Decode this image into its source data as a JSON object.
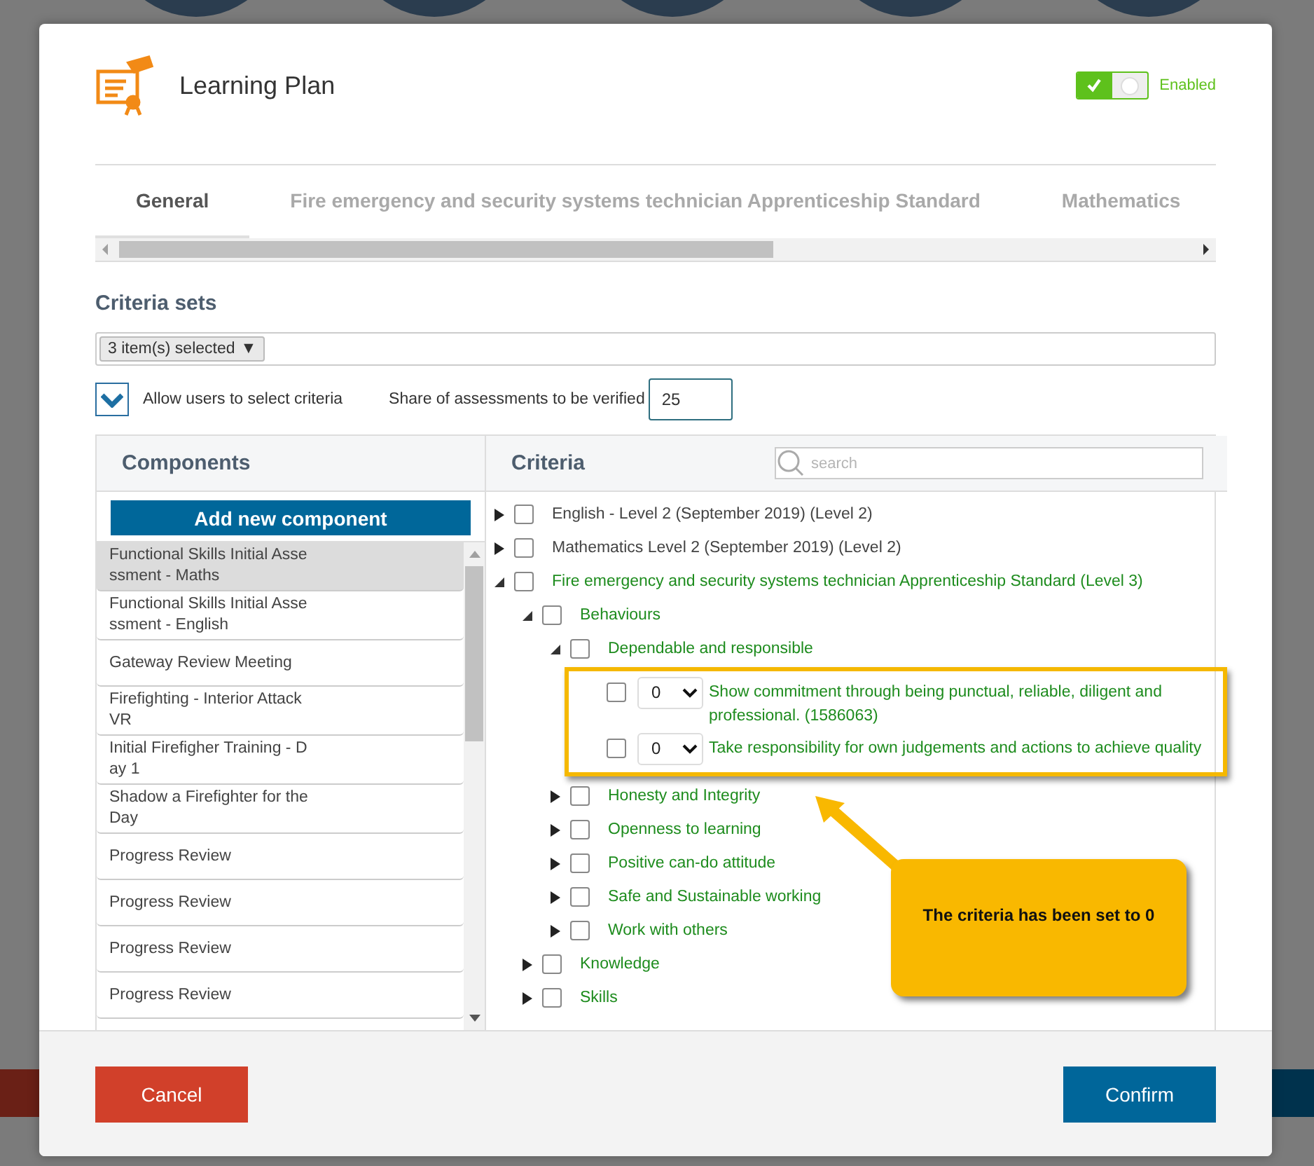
{
  "window": {
    "title": "Learning Plan"
  },
  "enabled_toggle": {
    "on": true,
    "label": "Enabled"
  },
  "tabs": [
    {
      "label": "General",
      "selected": true
    },
    {
      "label": "Fire emergency and security systems technician Apprenticeship Standard",
      "selected": false
    },
    {
      "label": "Mathematics",
      "selected": false
    }
  ],
  "criteria_sets": {
    "heading": "Criteria sets",
    "value": "3 item(s) selected",
    "caret": "▼"
  },
  "allow_select": {
    "label": "Allow users to select criteria",
    "checked": true
  },
  "share": {
    "label": "Share of assessments to be verified",
    "value": "25"
  },
  "components": {
    "heading": "Components",
    "add_button": "Add new component",
    "items": [
      {
        "label": "Functional Skills Initial Assessment - Maths",
        "selected": true
      },
      {
        "label": "Functional Skills Initial Assessment - English",
        "selected": false
      },
      {
        "label": "Gateway Review Meeting",
        "selected": false
      },
      {
        "label": "Firefighting - Interior Attack VR",
        "selected": false
      },
      {
        "label": "Initial Firefigher Training - Day 1",
        "selected": false
      },
      {
        "label": "Shadow a Firefighter for the Day",
        "selected": false
      },
      {
        "label": "Progress Review",
        "selected": false
      },
      {
        "label": "Progress Review",
        "selected": false
      },
      {
        "label": "Progress Review",
        "selected": false
      },
      {
        "label": "Progress Review",
        "selected": false
      }
    ]
  },
  "criteria": {
    "heading": "Criteria",
    "search": {
      "placeholder": "search"
    },
    "tree": [
      {
        "kind": "group",
        "label": "English - Level 2 (September 2019) (Level 2)",
        "checked": false,
        "expanded": false,
        "color": "#444444"
      },
      {
        "kind": "group",
        "label": "Mathematics Level 2 (September 2019) (Level 2)",
        "checked": false,
        "expanded": false,
        "color": "#444444"
      },
      {
        "kind": "group",
        "label": "Fire emergency and security systems technician Apprenticeship Standard (Level 3)",
        "checked": false,
        "expanded": true,
        "color": "#1e8c1e",
        "children": [
          {
            "kind": "group",
            "label": "Behaviours",
            "checked": false,
            "expanded": true,
            "color": "#1e8c1e",
            "children": [
              {
                "kind": "group",
                "label": "Dependable and responsible",
                "checked": false,
                "expanded": true,
                "color": "#1e8c1e",
                "children": [
                  {
                    "kind": "criterion",
                    "label": "Show commitment through being punctual, reliable, diligent and professional.  (1586063)",
                    "checked": false,
                    "score": "0",
                    "color": "#1e8c1e"
                  },
                  {
                    "kind": "criterion",
                    "label": "Take responsibility for own judgements and actions to achieve quality",
                    "checked": false,
                    "score": "0",
                    "color": "#1e8c1e"
                  }
                ]
              },
              {
                "kind": "group",
                "label": "Honesty and Integrity",
                "checked": false,
                "expanded": false,
                "color": "#1e8c1e"
              },
              {
                "kind": "group",
                "label": "Openness to learning",
                "checked": false,
                "expanded": false,
                "color": "#1e8c1e"
              },
              {
                "kind": "group",
                "label": "Positive can-do attitude",
                "checked": false,
                "expanded": false,
                "color": "#1e8c1e"
              },
              {
                "kind": "group",
                "label": "Safe and Sustainable working",
                "checked": false,
                "expanded": false,
                "color": "#1e8c1e"
              },
              {
                "kind": "group",
                "label": "Work with others",
                "checked": false,
                "expanded": false,
                "color": "#1e8c1e"
              }
            ]
          },
          {
            "kind": "group",
            "label": "Knowledge",
            "checked": false,
            "expanded": false,
            "color": "#1e8c1e"
          },
          {
            "kind": "group",
            "label": "Skills",
            "checked": false,
            "expanded": false,
            "color": "#1e8c1e"
          }
        ]
      }
    ]
  },
  "callout": {
    "text": "The criteria has been set to 0"
  },
  "buttons": {
    "cancel": "Cancel",
    "confirm": "Confirm"
  }
}
